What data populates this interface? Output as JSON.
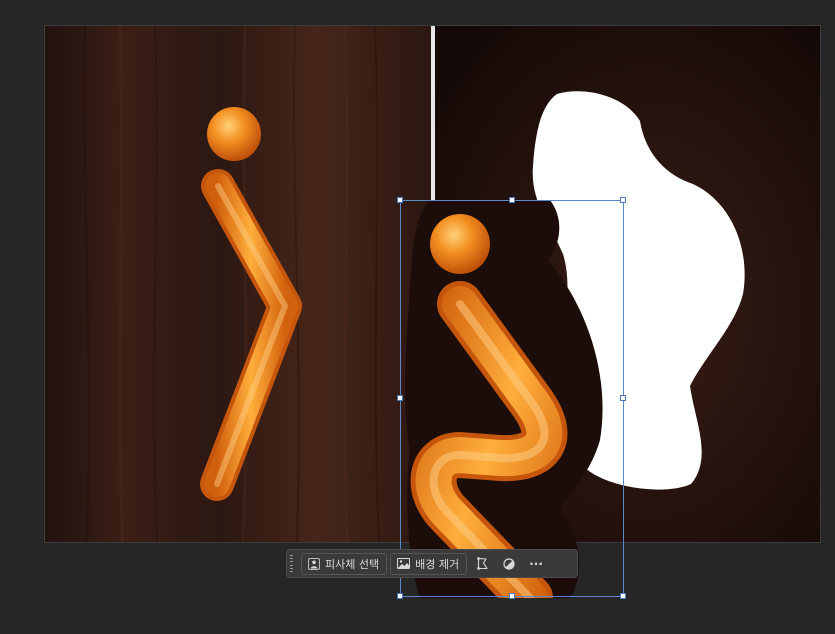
{
  "context_bar": {
    "select_subject_label": "피사체 선택",
    "remove_background_label": "배경 제거",
    "more_label": "···"
  },
  "icons": {
    "select_subject": "person-icon",
    "remove_background": "image-icon",
    "transform": "distort-icon",
    "adjustment": "half-circle-icon",
    "more": "ellipsis-icon"
  },
  "colors": {
    "workspace_bg": "#262626",
    "wood_dark": "#2a1612",
    "glow_orange": "#f07a16",
    "selection_blue": "#5a87c8",
    "mask_white": "#ffffff"
  }
}
